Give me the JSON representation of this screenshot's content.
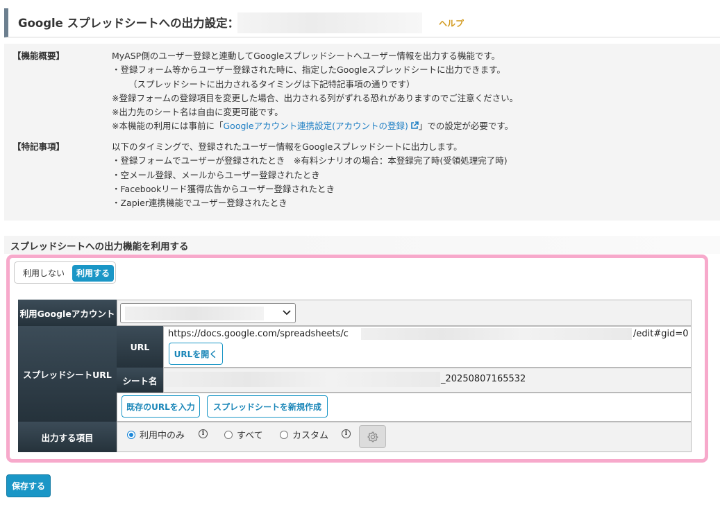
{
  "header": {
    "title": "Google スプレッドシートへの出力設定：",
    "help": "ヘルプ"
  },
  "info": {
    "overview_label": "【機能概要】",
    "overview_lines": [
      "MyASP側のユーザー登録と連動してGoogleスプレッドシートへユーザー情報を出力する機能です。",
      "・登録フォーム等からユーザー登録された時に、指定したGoogleスプレッドシートに出力できます。",
      "（スプレッドシートに出力されるタイミングは下記特記事項の通りです）",
      "※登録フォームの登録項目を変更した場合、出力される列がずれる恐れがありますのでご注意ください。",
      "※出力先のシート名は自由に変更可能です。"
    ],
    "link_prefix": "※本機能の利用には事前に「",
    "link_text": "Googleアカウント連携設定(アカウントの登録)",
    "link_suffix": "」での設定が必要です。",
    "notes_label": "【特記事項】",
    "notes_lines": [
      "以下のタイミングで、登録されたユーザー情報をGoogleスプレッドシートに出力します。",
      "・登録フォームでユーザーが登録されたとき　※有料シナリオの場合：本登録完了時(受領処理完了時)",
      "・空メール登録、メールからユーザー登録されたとき",
      "・Facebookリード獲得広告からユーザー登録されたとき",
      "・Zapier連携機能でユーザー登録されたとき"
    ]
  },
  "section": {
    "title": "スプレッドシートへの出力機能を利用する"
  },
  "toggle": {
    "off_label": "利用しない",
    "on_label": "利用する",
    "selected": "利用する"
  },
  "form": {
    "account_label": "利用Googleアカウント",
    "spreadsheet_url_label": "スプレッドシートURL",
    "url_label": "URL",
    "url_prefix": "https://docs.google.com/spreadsheets/c",
    "url_suffix": "/edit#gid=0",
    "open_url_button": "URLを開く",
    "sheet_name_label": "シート名",
    "sheet_name_suffix": "_20250807165532",
    "existing_url_button": "既存のURLを入力",
    "new_sheet_button": "スプレッドシートを新規作成",
    "output_items_label": "出力する項目",
    "radio_in_use": "利用中のみ",
    "radio_all": "すべて",
    "radio_custom": "カスタム",
    "radio_selected": "利用中のみ"
  },
  "save_button": "保存する",
  "colors": {
    "accent": "#1a96c6",
    "highlight_border": "#f7a9cb",
    "header_dark": "#2e3c46",
    "link": "#1f7fc4",
    "help": "#d29a1f"
  }
}
